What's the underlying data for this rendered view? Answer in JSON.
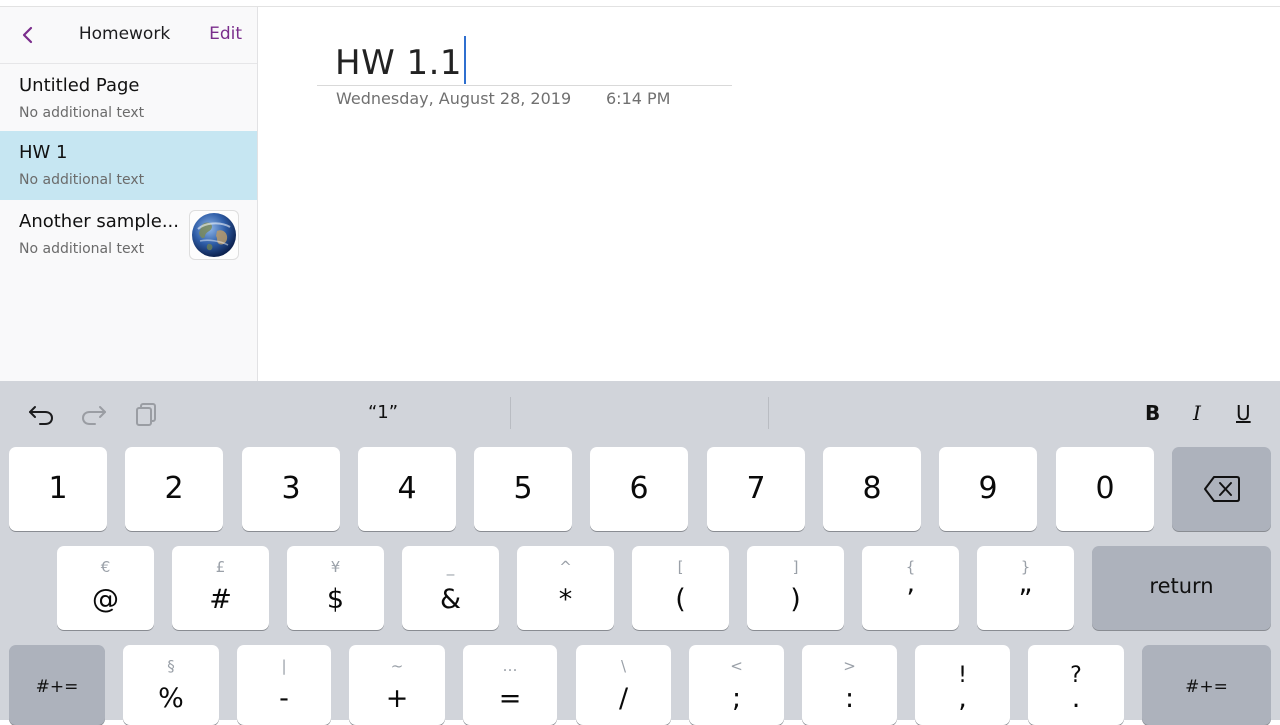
{
  "sidebar": {
    "back_icon": "chevron-left-icon",
    "title": "Homework",
    "edit_label": "Edit",
    "pages": [
      {
        "title": "Untitled Page",
        "subtitle": "No additional text",
        "selected": false
      },
      {
        "title": "HW 1",
        "subtitle": "No additional text",
        "selected": true
      },
      {
        "title": "Another sample...",
        "subtitle": "No additional text",
        "selected": false,
        "thumbnail": "earth-globe-image"
      }
    ]
  },
  "note": {
    "title": "HW 1.1",
    "date": "Wednesday, August 28, 2019",
    "time": "6:14 PM"
  },
  "keyboard": {
    "toolbar": {
      "undo_icon": "undo-icon",
      "redo_icon": "redo-icon",
      "paste_icon": "paste-icon",
      "suggestion": "“1”",
      "bold_label": "B",
      "italic_label": "I",
      "underline_label": "U"
    },
    "row1": [
      "1",
      "2",
      "3",
      "4",
      "5",
      "6",
      "7",
      "8",
      "9",
      "0"
    ],
    "backspace_icon": "backspace-icon",
    "row2": [
      {
        "main": "@",
        "alt": "€"
      },
      {
        "main": "#",
        "alt": "£"
      },
      {
        "main": "$",
        "alt": "¥"
      },
      {
        "main": "&",
        "alt": "_"
      },
      {
        "main": "*",
        "alt": "^"
      },
      {
        "main": "(",
        "alt": "["
      },
      {
        "main": ")",
        "alt": "]"
      },
      {
        "main": "’",
        "alt": "{"
      },
      {
        "main": "”",
        "alt": "}"
      }
    ],
    "return_label": "return",
    "row3_left": "#+=",
    "row3": [
      {
        "main": "%",
        "alt": "§"
      },
      {
        "main": "-",
        "alt": "|"
      },
      {
        "main": "+",
        "alt": "~"
      },
      {
        "main": "=",
        "alt": "…"
      },
      {
        "main": "/",
        "alt": "\\"
      },
      {
        "main": ";",
        "alt": "<"
      },
      {
        "main": ":",
        "alt": ">"
      },
      {
        "main": ",",
        "alt": "!"
      },
      {
        "main": ".",
        "alt": "?"
      }
    ],
    "row3_right": "#+="
  }
}
